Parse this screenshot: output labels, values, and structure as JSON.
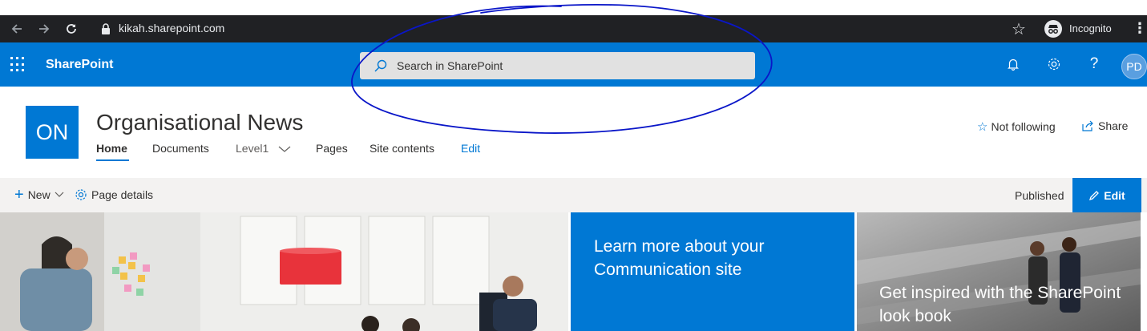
{
  "browser": {
    "url": "kikah.sharepoint.com",
    "incognito_label": "Incognito",
    "back_icon": "arrow-left-icon",
    "forward_icon": "arrow-right-icon",
    "reload_icon": "reload-icon",
    "menu_icon": "kebab-menu-icon"
  },
  "suite": {
    "brand": "SharePoint",
    "search_placeholder": "Search in SharePoint",
    "avatar_initials": "PD",
    "accent": "#0078d4"
  },
  "site": {
    "logo_initials": "ON",
    "title": "Organisational News",
    "nav": [
      {
        "label": "Home",
        "active": true
      },
      {
        "label": "Documents"
      },
      {
        "label": "Level1",
        "has_dropdown": true
      },
      {
        "label": "Pages"
      },
      {
        "label": "Site contents"
      },
      {
        "label": "Edit",
        "accent": true
      }
    ],
    "follow_label": "Not following",
    "share_label": "Share"
  },
  "commandbar": {
    "new_label": "New",
    "page_details_label": "Page details",
    "status": "Published",
    "edit_label": "Edit"
  },
  "hero": {
    "tile2_text": "Learn more about your Communication site",
    "tile3_text": "Get inspired with the SharePoint look book"
  },
  "annotation": {
    "color": "#0a16c8",
    "shape": "hand-drawn ellipse around search box"
  }
}
